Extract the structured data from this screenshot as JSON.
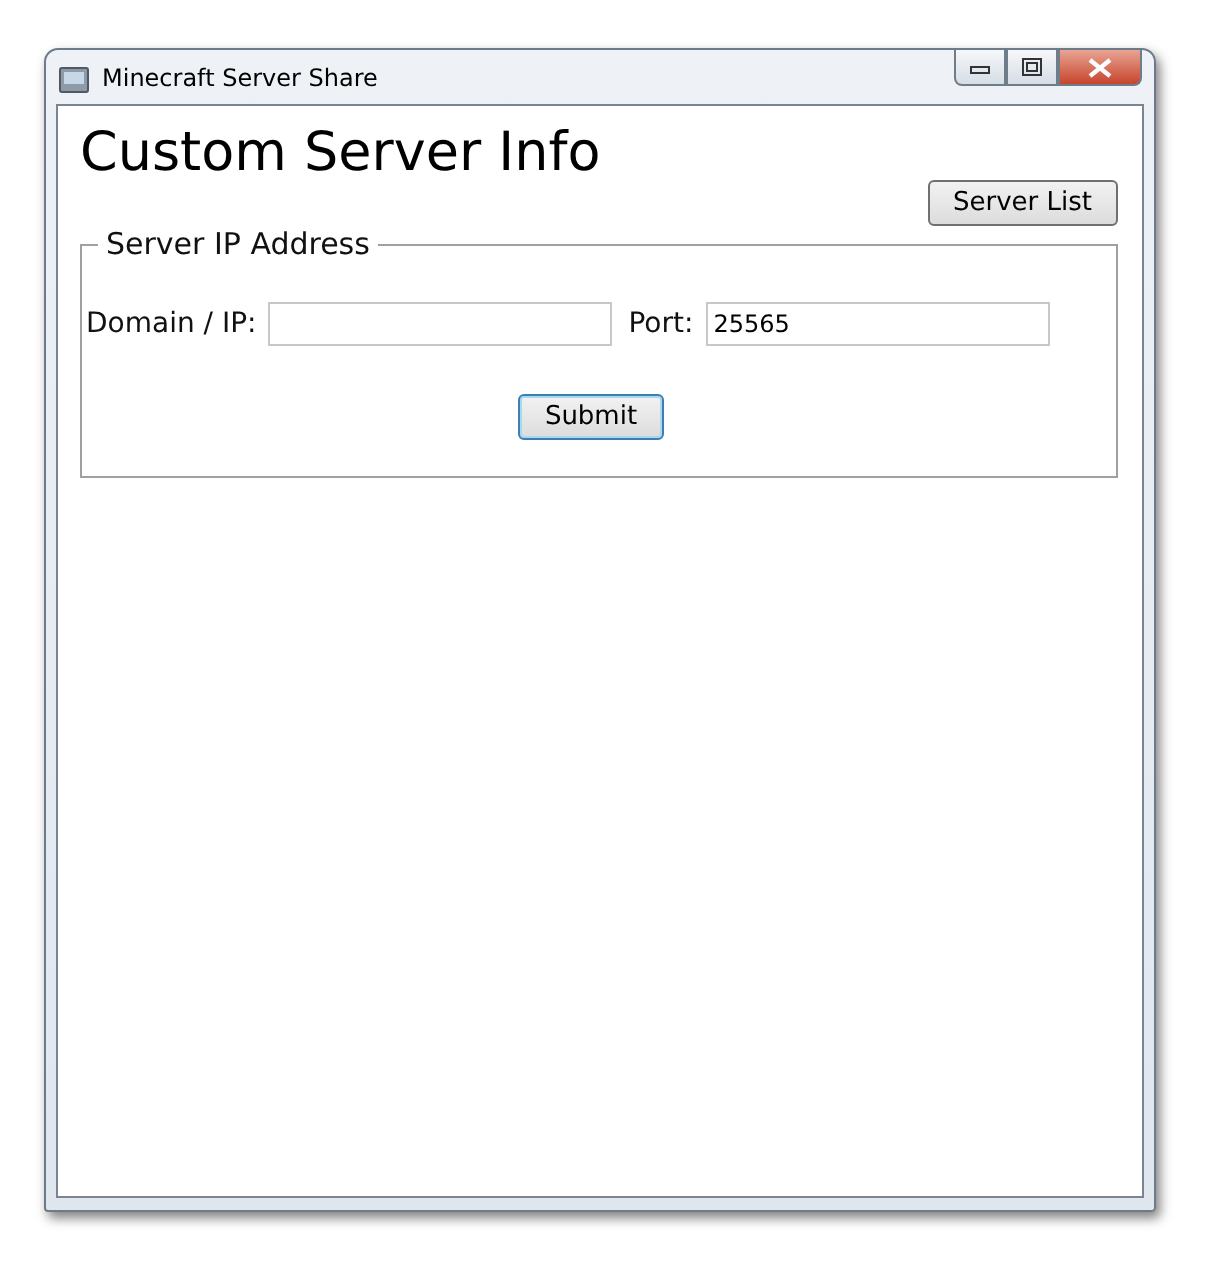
{
  "window": {
    "title": "Minecraft Server Share"
  },
  "heading": "Custom Server Info",
  "server_list_button": "Server List",
  "group": {
    "title": "Server IP Address",
    "fields": [
      {
        "label": "Domain / IP:"
      },
      {
        "label": "Port:",
        "value": "25565"
      }
    ],
    "submit_button": "Submit"
  }
}
